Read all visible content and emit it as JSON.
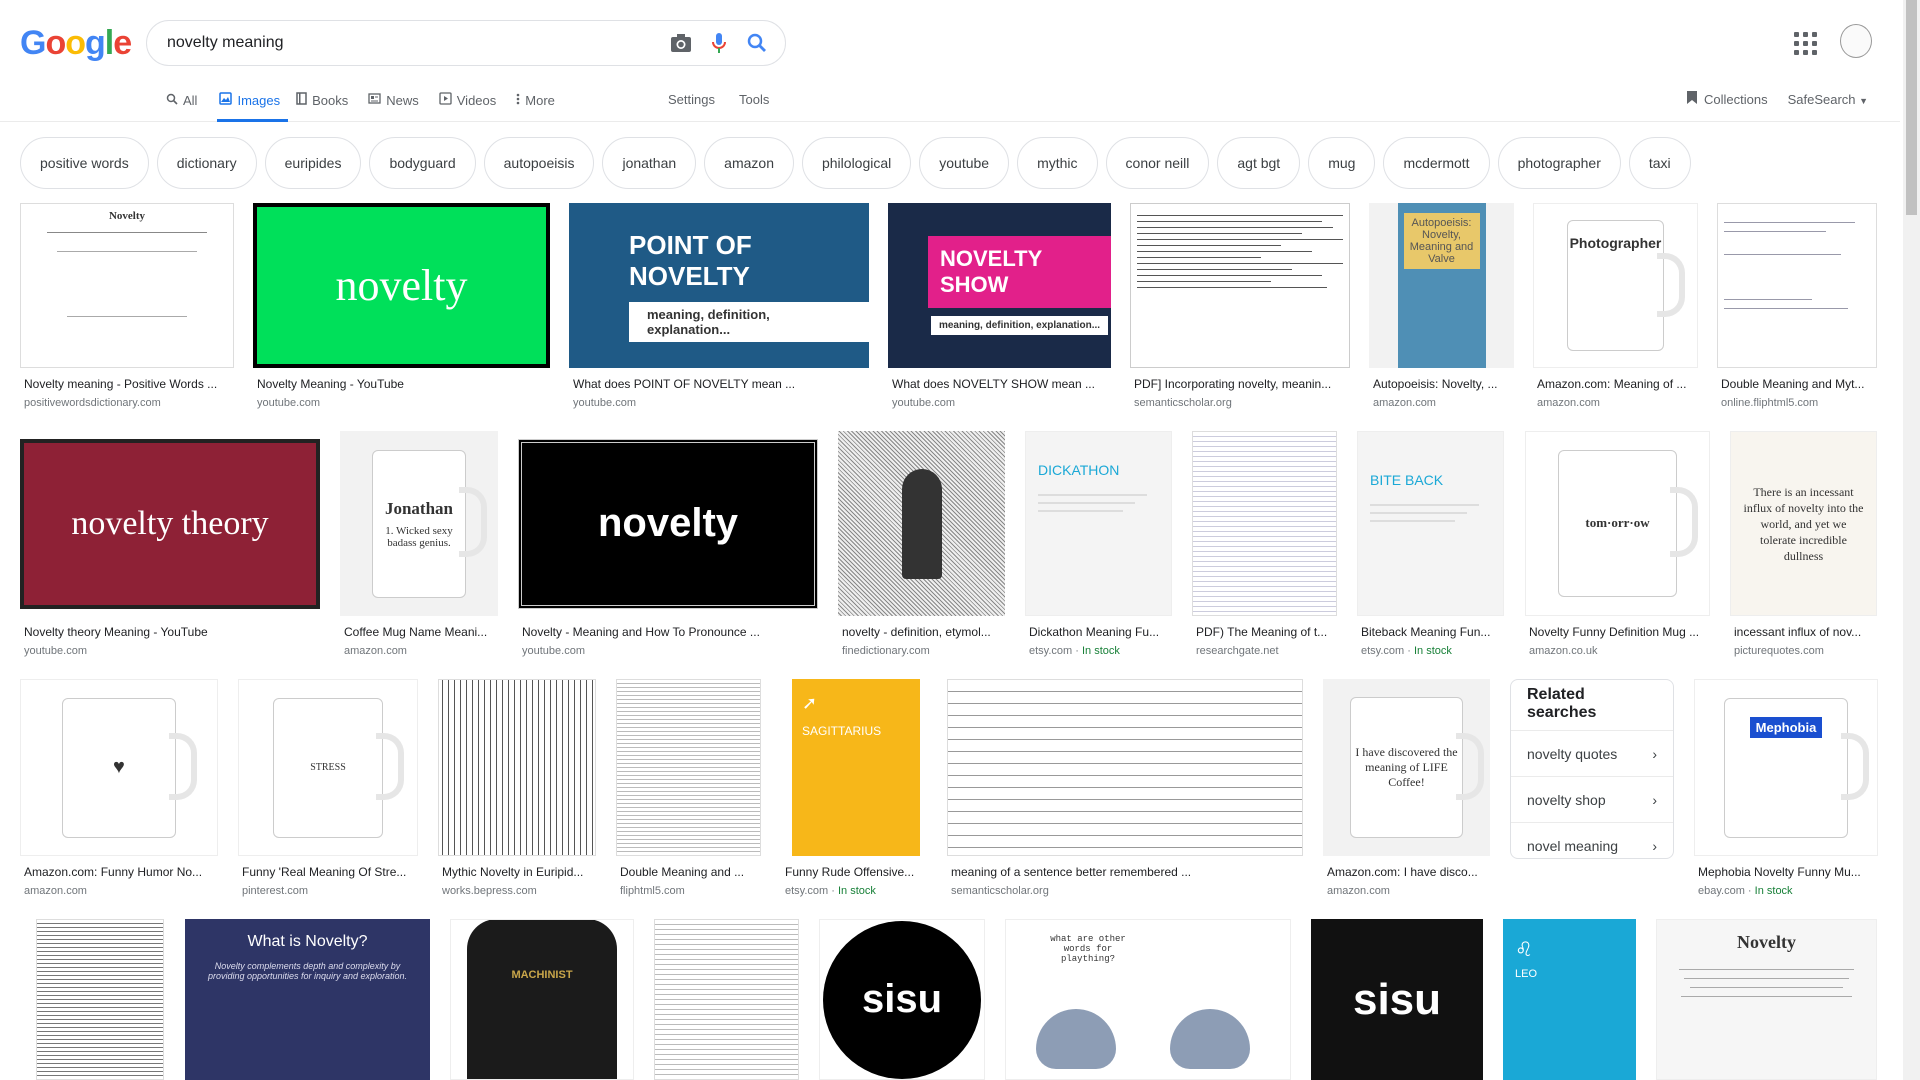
{
  "logo": "Google",
  "search": {
    "value": "novelty meaning"
  },
  "tabs": [
    {
      "label": "All",
      "icon": "search-icon"
    },
    {
      "label": "Images",
      "icon": "image-icon"
    },
    {
      "label": "Books",
      "icon": "book-icon"
    },
    {
      "label": "News",
      "icon": "news-icon"
    },
    {
      "label": "Videos",
      "icon": "video-icon"
    },
    {
      "label": "More",
      "icon": "more-vert-icon"
    }
  ],
  "tools": {
    "settings": "Settings",
    "tools": "Tools"
  },
  "right": {
    "collections": "Collections",
    "safesearch": "SafeSearch"
  },
  "chips": [
    "positive words",
    "dictionary",
    "euripides",
    "bodyguard",
    "autopoeisis",
    "jonathan",
    "amazon",
    "philological",
    "youtube",
    "mythic",
    "conor neill",
    "agt bgt",
    "mug",
    "mcdermott",
    "photographer",
    "taxi"
  ],
  "results": {
    "row1": [
      {
        "caption": "Novelty meaning - Positive Words ...",
        "source": "positivewordsdictionary.com",
        "thumb_text": "Novelty"
      },
      {
        "caption": "Novelty Meaning - YouTube",
        "source": "youtube.com",
        "thumb_text": "novelty"
      },
      {
        "caption": "What does POINT OF NOVELTY mean ...",
        "source": "youtube.com",
        "thumb_text": "POINT OF NOVELTY",
        "thumb_sub": "meaning, definition, explanation..."
      },
      {
        "caption": "What does NOVELTY SHOW mean ...",
        "source": "youtube.com",
        "thumb_text": "NOVELTY SHOW",
        "thumb_sub": "meaning, definition, explanation..."
      },
      {
        "caption": "PDF] Incorporating novelty, meanin...",
        "source": "semanticscholar.org"
      },
      {
        "caption": "Autopoeisis: Novelty, ...",
        "source": "amazon.com",
        "thumb_text": "Autopoeisis: Novelty, Meaning and Valve"
      },
      {
        "caption": "Amazon.com: Meaning of ...",
        "source": "amazon.com",
        "thumb_text": "Photographer"
      },
      {
        "caption": "Double Meaning and Myt...",
        "source": "online.fliphtml5.com"
      }
    ],
    "row2": [
      {
        "caption": "Novelty theory Meaning - YouTube",
        "source": "youtube.com",
        "thumb_text": "novelty theory"
      },
      {
        "caption": "Coffee Mug Name Meani...",
        "source": "amazon.com",
        "thumb_text": "Jonathan",
        "thumb_sub": "1. Wicked sexy badass genius."
      },
      {
        "caption": "Novelty - Meaning and How To Pronounce ...",
        "source": "youtube.com",
        "thumb_text": "novelty"
      },
      {
        "caption": "novelty - definition, etymol...",
        "source": "finedictionary.com"
      },
      {
        "caption": "Dickathon Meaning Fu...",
        "source": "etsy.com",
        "stock": "In stock",
        "thumb_text": "DICKATHON"
      },
      {
        "caption": "PDF) The Meaning of t...",
        "source": "researchgate.net"
      },
      {
        "caption": "Biteback Meaning Fun...",
        "source": "etsy.com",
        "stock": "In stock",
        "thumb_text": "BITE BACK"
      },
      {
        "caption": "Novelty Funny Definition Mug ...",
        "source": "amazon.co.uk",
        "thumb_text": "tom·orr·ow"
      },
      {
        "caption": "incessant influx of nov...",
        "source": "picturequotes.com",
        "thumb_text": "There is an incessant influx of novelty into the world, and yet we tolerate incredible dullness"
      }
    ],
    "row3": [
      {
        "caption": "Amazon.com: Funny Humor No...",
        "source": "amazon.com"
      },
      {
        "caption": "Funny 'Real Meaning Of Stre...",
        "source": "pinterest.com",
        "thumb_text": "STRESS"
      },
      {
        "caption": "Mythic Novelty in Euripid...",
        "source": "works.bepress.com"
      },
      {
        "caption": "Double Meaning and ...",
        "source": "fliphtml5.com"
      },
      {
        "caption": "Funny Rude Offensive...",
        "source": "etsy.com",
        "stock": "In stock",
        "thumb_text": "SAGITTARIUS"
      },
      {
        "caption": "meaning of a sentence better remembered ...",
        "source": "semanticscholar.org"
      },
      {
        "caption": "Amazon.com: I have disco...",
        "source": "amazon.com",
        "thumb_text": "I have discovered the meaning of LIFE Coffee!"
      },
      {
        "caption": "Mephobia Novelty Funny Mu...",
        "source": "ebay.com",
        "stock": "In stock",
        "thumb_text": "Mephobia"
      }
    ],
    "row4": [
      {
        "thumb_text": ""
      },
      {
        "thumb_text": "What is Novelty?",
        "thumb_sub": "Novelty complements depth and complexity by providing opportunities for inquiry and exploration."
      },
      {
        "thumb_text": "MACHINIST"
      },
      {
        "thumb_text": ""
      },
      {
        "thumb_text": "sisu"
      },
      {
        "thumb_text": "what are other words for plaything?"
      },
      {
        "thumb_text": "sisu"
      },
      {
        "thumb_text": "LEO"
      },
      {
        "thumb_text": "Novelty"
      }
    ]
  },
  "related": {
    "title": "Related searches",
    "items": [
      "novelty quotes",
      "novelty shop",
      "novel meaning"
    ]
  },
  "colors": {
    "accent": "#1a73e8",
    "stock": "#188038"
  }
}
